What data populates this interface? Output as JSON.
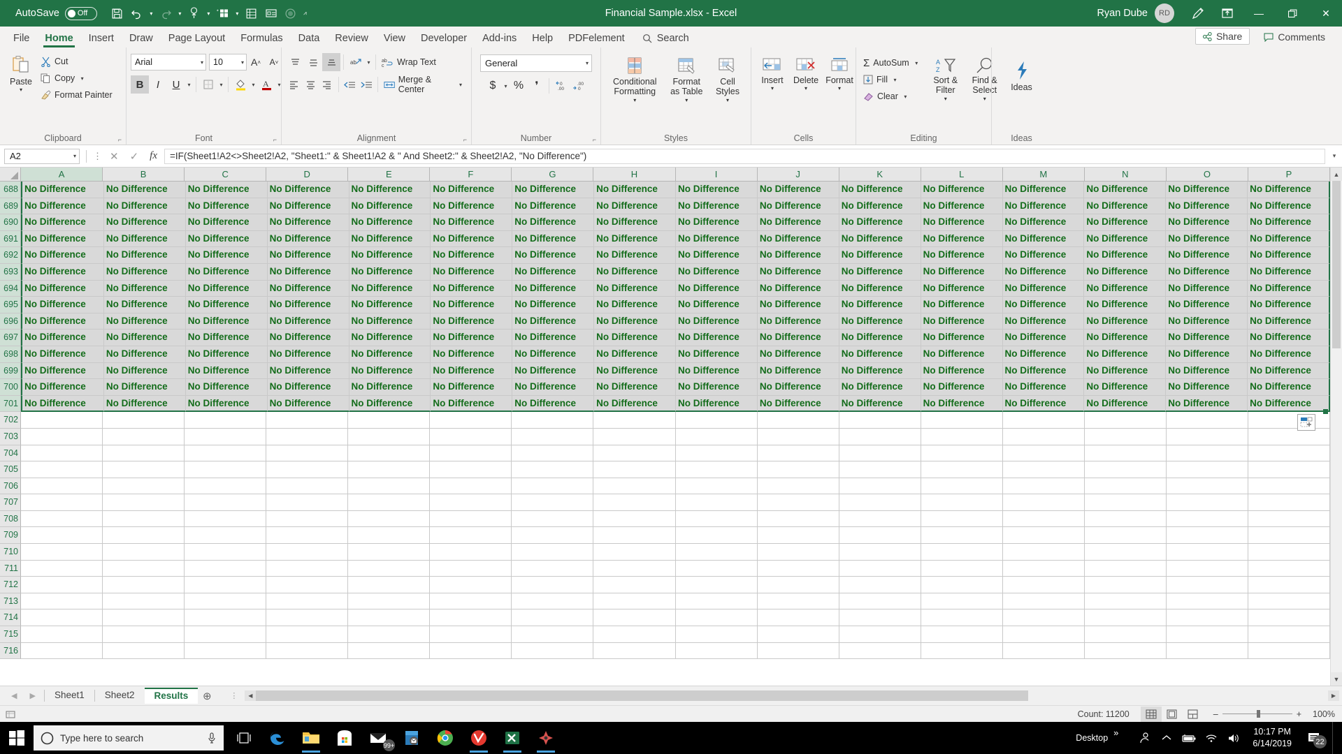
{
  "titlebar": {
    "autosave_label": "AutoSave",
    "autosave_state": "Off",
    "document_title": "Financial Sample.xlsx  -  Excel",
    "user_name": "Ryan Dube",
    "user_initials": "RD",
    "qat": [
      "save-icon",
      "undo-icon",
      "redo-icon",
      "touch-mode-icon",
      "new-icon",
      "sort-icon",
      "form-icon",
      "record-icon",
      "customize-qat-icon"
    ],
    "window_buttons": [
      "minimize",
      "restore",
      "close"
    ],
    "ribbon_display_icon": "ribbon-display-options-icon",
    "pen_icon": "draw-icon"
  },
  "tabs": {
    "items": [
      "File",
      "Home",
      "Insert",
      "Draw",
      "Page Layout",
      "Formulas",
      "Data",
      "Review",
      "View",
      "Developer",
      "Add-ins",
      "Help",
      "PDFelement"
    ],
    "active": "Home",
    "search_placeholder": "Search",
    "share_label": "Share",
    "comments_label": "Comments"
  },
  "ribbon": {
    "groups": [
      {
        "label": "Clipboard",
        "paste_label": "Paste",
        "items": [
          "Cut",
          "Copy",
          "Format Painter"
        ]
      },
      {
        "label": "Font",
        "font_name": "Arial",
        "font_size": "10",
        "buttons": [
          "Grow Font",
          "Shrink Font",
          "Bold",
          "Italic",
          "Underline",
          "Borders",
          "Fill Color",
          "Font Color"
        ]
      },
      {
        "label": "Alignment",
        "wrap_text": "Wrap Text",
        "merge_center": "Merge & Center",
        "buttons": [
          "Top Align",
          "Middle Align",
          "Bottom Align",
          "Orientation",
          "Align Left",
          "Center",
          "Align Right",
          "Decrease Indent",
          "Increase Indent"
        ]
      },
      {
        "label": "Number",
        "format": "General",
        "buttons": [
          "Accounting Number Format",
          "Percent Style",
          "Comma Style",
          "Increase Decimal",
          "Decrease Decimal"
        ]
      },
      {
        "label": "Styles",
        "items": [
          "Conditional Formatting",
          "Format as Table",
          "Cell Styles"
        ]
      },
      {
        "label": "Cells",
        "items": [
          "Insert",
          "Delete",
          "Format"
        ]
      },
      {
        "label": "Editing",
        "items": [
          "AutoSum",
          "Fill",
          "Clear",
          "Sort & Filter",
          "Find & Select"
        ]
      },
      {
        "label": "Ideas",
        "items": [
          "Ideas"
        ]
      }
    ]
  },
  "formula_bar": {
    "name_box": "A2",
    "formula": "=IF(Sheet1!A2<>Sheet2!A2, \"Sheet1:\" & Sheet1!A2 & \" And Sheet2:\" & Sheet2!A2, \"No Difference\")",
    "cancel_icon": "cancel-icon",
    "enter_icon": "enter-icon",
    "fx_icon": "insert-function-icon",
    "expand_icon": "expand-formula-bar-icon"
  },
  "grid": {
    "columns": [
      "A",
      "B",
      "C",
      "D",
      "E",
      "F",
      "G",
      "H",
      "I",
      "J",
      "K",
      "L",
      "M",
      "N",
      "O",
      "P"
    ],
    "filled_rows": [
      "688",
      "689",
      "690",
      "691",
      "692",
      "693",
      "694",
      "695",
      "696",
      "697",
      "698",
      "699",
      "700",
      "701"
    ],
    "empty_rows": [
      "702",
      "703",
      "704",
      "705",
      "706",
      "707",
      "708",
      "709",
      "710",
      "711",
      "712",
      "713",
      "714",
      "715",
      "716"
    ],
    "cell_value": "No Difference",
    "cell_text_color": "#136c1a",
    "cell_fill_color": "#d9d9d9",
    "selection_border_color": "#217346",
    "quick_button": "paste-options-icon"
  },
  "sheets": {
    "tabs": [
      "Sheet1",
      "Sheet2",
      "Results"
    ],
    "active": "Results",
    "add_label": "+"
  },
  "status_bar": {
    "count_label": "Count: 11200",
    "views": [
      "normal-view-icon",
      "page-layout-view-icon",
      "page-break-preview-icon"
    ],
    "active_view": "normal-view-icon",
    "zoom_out": "–",
    "zoom_in": "+",
    "zoom_level": "100%"
  },
  "taskbar": {
    "search_placeholder": "Type here to search",
    "apps": [
      "task-view-icon",
      "edge-icon",
      "file-explorer-icon",
      "microsoft-store-icon",
      "mail-icon",
      "outlook-icon",
      "chrome-icon",
      "vivaldi-icon",
      "excel-icon",
      "app-icon"
    ],
    "mail_badge": "99+",
    "desktop_label": "Desktop",
    "overflow_label": "»",
    "time": "10:17 PM",
    "date": "6/14/2019",
    "notification_count": "22"
  }
}
